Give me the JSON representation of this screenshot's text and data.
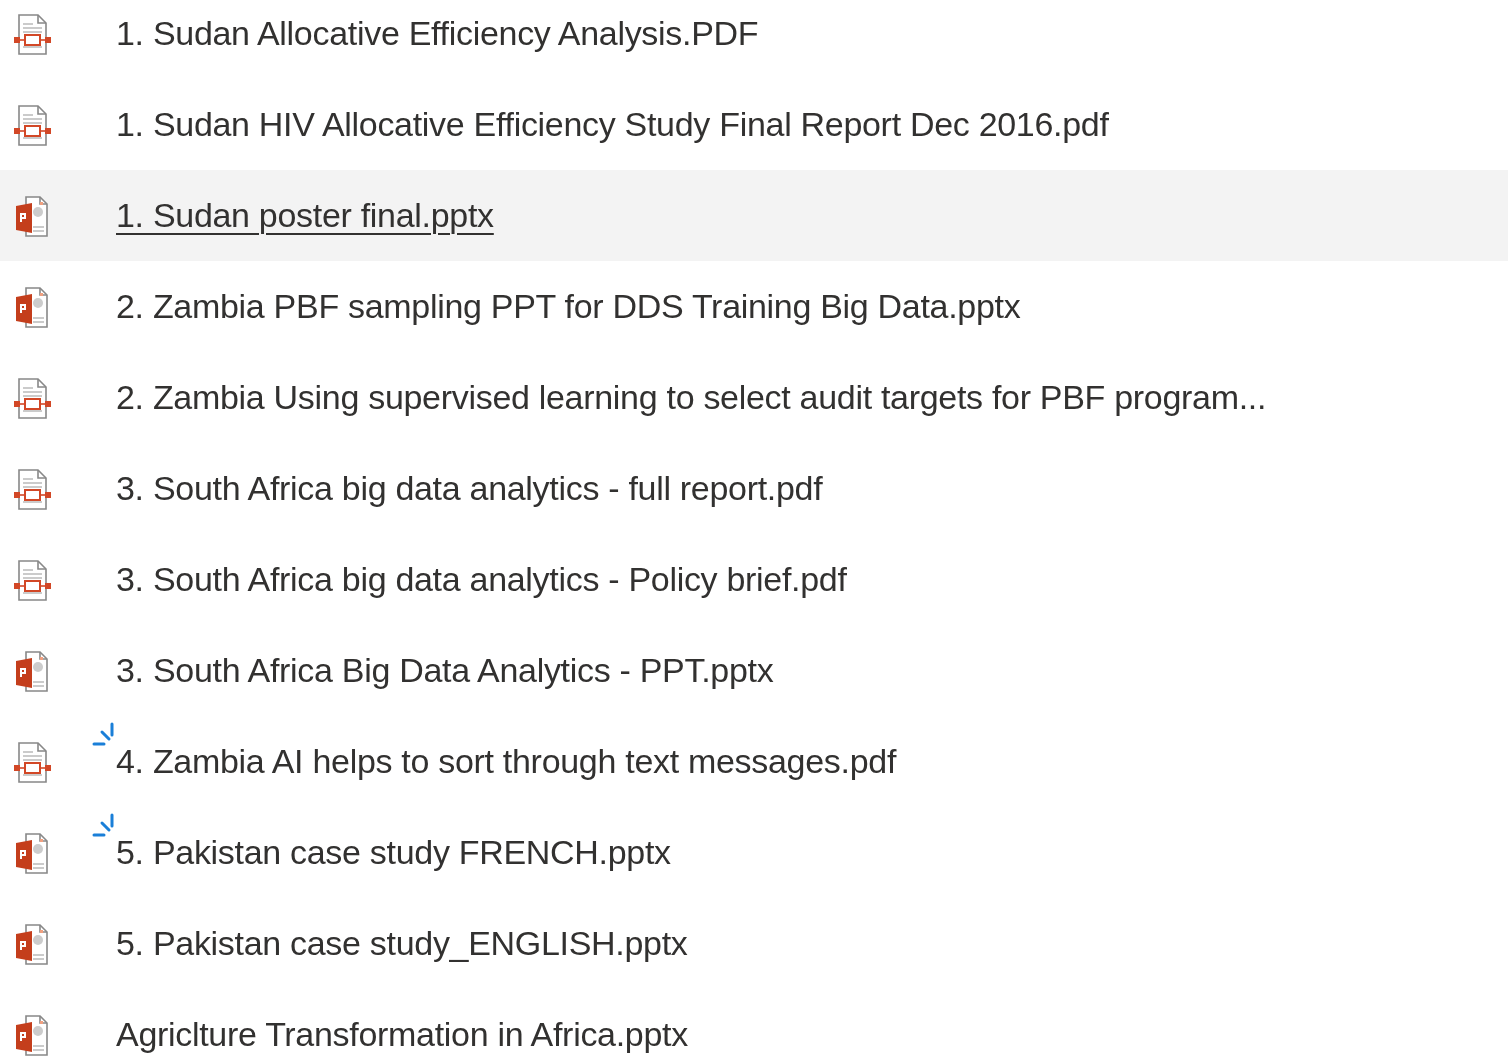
{
  "files": [
    {
      "kind": "pdf",
      "name": "1. Sudan Allocative Efficiency Analysis.PDF",
      "selected": false,
      "new": false
    },
    {
      "kind": "pdf",
      "name": "1. Sudan HIV Allocative Efficiency Study Final Report Dec 2016.pdf",
      "selected": false,
      "new": false
    },
    {
      "kind": "pptx",
      "name": "1. Sudan poster final.pptx",
      "selected": true,
      "new": false
    },
    {
      "kind": "pptx",
      "name": "2. Zambia PBF sampling PPT for DDS Training Big Data.pptx",
      "selected": false,
      "new": false
    },
    {
      "kind": "pdf",
      "name": "2. Zambia Using supervised learning to select audit targets for PBF program...",
      "selected": false,
      "new": false
    },
    {
      "kind": "pdf",
      "name": "3. South Africa big data analytics - full report.pdf",
      "selected": false,
      "new": false
    },
    {
      "kind": "pdf",
      "name": "3. South Africa big data analytics - Policy brief.pdf",
      "selected": false,
      "new": false
    },
    {
      "kind": "pptx",
      "name": "3. South Africa Big Data Analytics - PPT.pptx",
      "selected": false,
      "new": false
    },
    {
      "kind": "pdf",
      "name": "4. Zambia AI helps to sort through text messages.pdf",
      "selected": false,
      "new": true
    },
    {
      "kind": "pptx",
      "name": "5. Pakistan case study FRENCH.pptx",
      "selected": false,
      "new": true
    },
    {
      "kind": "pptx",
      "name": "5. Pakistan case study_ENGLISH.pptx",
      "selected": false,
      "new": false
    },
    {
      "kind": "pptx",
      "name": "Agriclture Transformation in Africa.pptx",
      "selected": false,
      "new": false
    }
  ]
}
